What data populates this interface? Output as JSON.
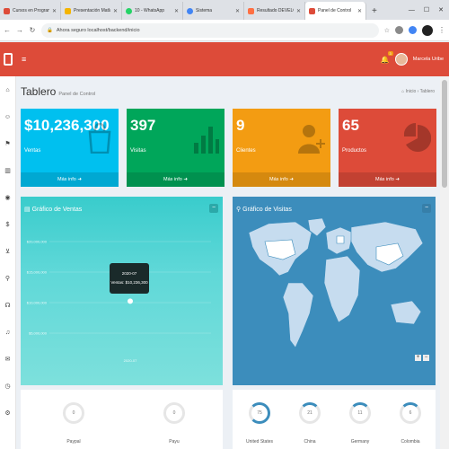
{
  "browser": {
    "tabs": [
      {
        "label": "Cursos en Programación",
        "color": "#dd4b39"
      },
      {
        "label": "Presentación Matlab",
        "color": "#f4b400"
      },
      {
        "label": "10 - WhatsApp",
        "color": "#25d366"
      },
      {
        "label": "Sistema",
        "color": "#4285f4"
      },
      {
        "label": "Resultado DEVELOPM",
        "color": "#ff7043"
      },
      {
        "label": "Panel de Control",
        "color": "#dd4b39"
      }
    ],
    "new_tab": "+",
    "url": "Ahora seguro  localhost/backend/inicio"
  },
  "header": {
    "menu_icon": "≡",
    "notifications": "3",
    "user_name": "Marcela Uribe"
  },
  "page": {
    "title": "Tablero",
    "subtitle": "Panel de Control",
    "breadcrumb": "⌂ Inicio › Tablero"
  },
  "stats": [
    {
      "value": "$10,236,300",
      "label": "Ventas",
      "footer": "Más info",
      "color": "#00c0ef"
    },
    {
      "value": "397",
      "label": "Visitas",
      "footer": "Más info",
      "color": "#00a65a"
    },
    {
      "value": "9",
      "label": "Clientes",
      "footer": "Más info",
      "color": "#f39c12"
    },
    {
      "value": "65",
      "label": "Productos",
      "footer": "Más info",
      "color": "#dd4b39"
    }
  ],
  "sales_panel": {
    "title": "Gráfico de Ventas",
    "tool": "−",
    "tooltip_date": "2020-07",
    "tooltip_value": "Ventas: $10,236,300"
  },
  "chart_data": {
    "type": "line",
    "x": [
      "2020-07"
    ],
    "series": [
      {
        "values": [
          10236300
        ]
      }
    ],
    "yticks": [
      "$20,000,000",
      "$15,000,000",
      "$10,000,000",
      "$5,000,000"
    ],
    "xticks": [
      "2020-07"
    ],
    "ylim": [
      0,
      20000000
    ]
  },
  "visits_panel": {
    "title": "Gráfico de Visitas",
    "tool": "−",
    "zoom_in": "+",
    "zoom_out": "−"
  },
  "bottom_left": [
    {
      "label": "Paypal",
      "value": "0"
    },
    {
      "label": "Payu",
      "value": "0"
    }
  ],
  "bottom_right": [
    {
      "label": "United States",
      "value": "75"
    },
    {
      "label": "China",
      "value": "21"
    },
    {
      "label": "Germany",
      "value": "11"
    },
    {
      "label": "Colombia",
      "value": "6"
    }
  ]
}
